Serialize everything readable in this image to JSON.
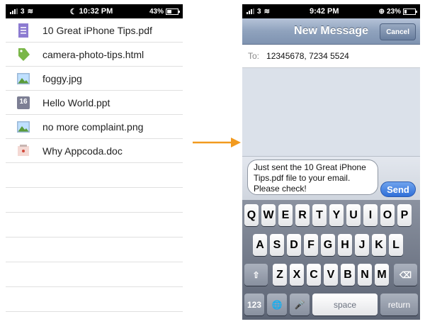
{
  "left_screen": {
    "status": {
      "carrier": "3",
      "time": "10:32 PM",
      "battery": "43%"
    },
    "files": [
      {
        "name": "10 Great iPhone Tips.pdf",
        "icon": "pdf-document-icon"
      },
      {
        "name": "camera-photo-tips.html",
        "icon": "html-tag-icon"
      },
      {
        "name": "foggy.jpg",
        "icon": "image-file-icon"
      },
      {
        "name": "Hello World.ppt",
        "icon": "calendar-ppt-icon",
        "badge": "16"
      },
      {
        "name": "no more complaint.png",
        "icon": "image-file-icon"
      },
      {
        "name": "Why Appcoda.doc",
        "icon": "doc-file-icon"
      }
    ]
  },
  "arrow_color": "#f29a1f",
  "right_screen": {
    "status": {
      "carrier": "3",
      "time": "9:42 PM",
      "battery": "23%"
    },
    "nav": {
      "title": "New Message",
      "cancel_label": "Cancel"
    },
    "to": {
      "label": "To:",
      "value": "12345678, 7234 5524"
    },
    "message": {
      "lines": [
        "Just sent the 10 Great iPhone",
        "Tips.pdf file to your email.",
        "Please check!"
      ],
      "send_label": "Send"
    },
    "keyboard": {
      "row1": [
        "Q",
        "W",
        "E",
        "R",
        "T",
        "Y",
        "U",
        "I",
        "O",
        "P"
      ],
      "row2": [
        "A",
        "S",
        "D",
        "F",
        "G",
        "H",
        "J",
        "K",
        "L"
      ],
      "row3": [
        "Z",
        "X",
        "C",
        "V",
        "B",
        "N",
        "M"
      ],
      "shift_icon": "⇧",
      "delete_icon": "⌫",
      "numbers_label": "123",
      "globe_icon": "🌐",
      "mic_icon": "🎤",
      "space_label": "space",
      "return_label": "return"
    }
  }
}
